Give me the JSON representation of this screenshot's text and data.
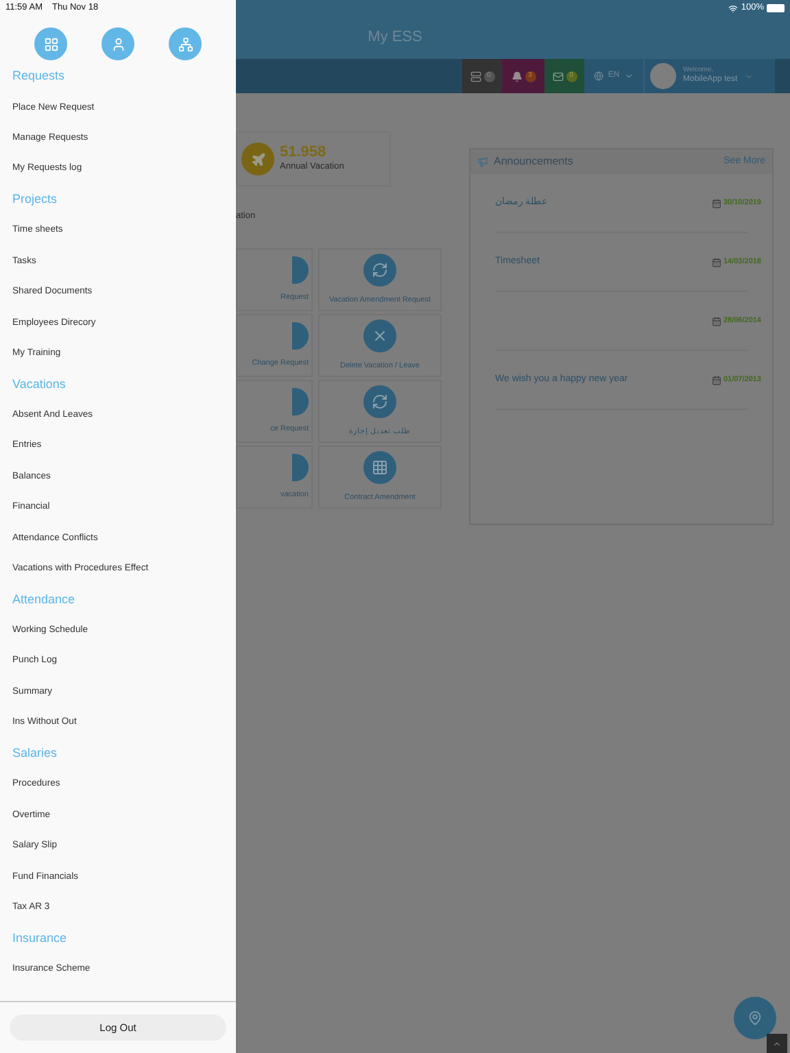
{
  "status_bar": {
    "time": "11:59 AM",
    "date": "Thu Nov 18",
    "battery": "100%"
  },
  "header": {
    "title": "My ESS"
  },
  "toolbar": {
    "tasks_count": "0",
    "notifications_count": "3",
    "messages_count": "0",
    "language": "EN",
    "welcome": "Welcome,",
    "user": "MobileApp test"
  },
  "summary": {
    "value": "51.958",
    "label": "Annual Vacation",
    "section_label": "ation"
  },
  "tiles": [
    {
      "label": "Request"
    },
    {
      "label": "Vacation Amendment Request"
    },
    {
      "label": "Change Request"
    },
    {
      "label": "Delete Vacation / Leave"
    },
    {
      "label": "ce Request"
    },
    {
      "label": "طلب تعديل إجازة"
    },
    {
      "label": "vacation"
    },
    {
      "label": "Contract Amendment"
    }
  ],
  "announcements": {
    "title": "Announcements",
    "see_more": "See More",
    "items": [
      {
        "text": "عطلة رمضان",
        "date": "30/10/2019"
      },
      {
        "text": "Timesheet",
        "date": "14/03/2018"
      },
      {
        "date": "28/06/2014"
      },
      {
        "text": "We wish you a happy new year",
        "date": "01/07/2013"
      }
    ]
  },
  "drawer": {
    "sections": [
      {
        "title": "Requests",
        "items": [
          "Place New Request",
          "Manage Requests",
          "My Requests log"
        ]
      },
      {
        "title": "Projects",
        "items": [
          "Time sheets",
          "Tasks",
          "Shared Documents",
          "Employees Direcory",
          "My Training"
        ]
      },
      {
        "title": "Vacations",
        "items": [
          "Absent And Leaves",
          "Entries",
          "Balances",
          "Financial",
          "Attendance Conflicts",
          "Vacations with Procedures Effect"
        ]
      },
      {
        "title": "Attendance",
        "items": [
          "Working Schedule",
          "Punch Log",
          "Summary",
          "Ins Without Out"
        ]
      },
      {
        "title": "Salaries",
        "items": [
          "Procedures",
          "Overtime",
          "Salary Slip",
          "Fund Financials",
          "Tax AR 3"
        ]
      },
      {
        "title": "Insurance",
        "items": [
          "Insurance Scheme"
        ]
      }
    ],
    "logout": "Log Out"
  }
}
